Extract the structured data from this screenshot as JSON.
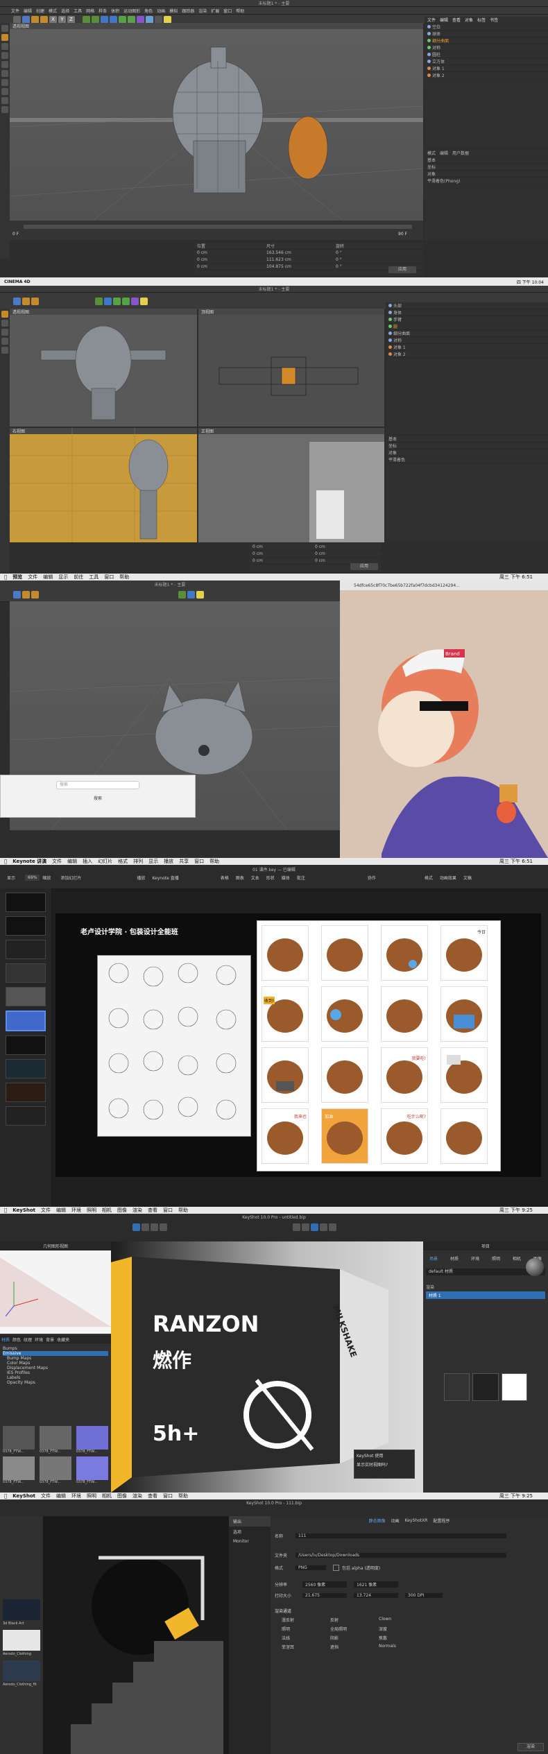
{
  "c4d_1": {
    "window_title": "未标题1 * - 主要",
    "menu_items": [
      "文件",
      "编辑",
      "创建",
      "模式",
      "选择",
      "工具",
      "网格",
      "样条",
      "体积",
      "运动图形",
      "角色",
      "动画",
      "模拟",
      "跟踪器",
      "渲染",
      "扩展",
      "窗口",
      "帮助"
    ],
    "tool_letters": [
      "X",
      "Y",
      "Z"
    ],
    "viewport_label": "透视视图",
    "object_manager_tabs": [
      "文件",
      "编辑",
      "查看",
      "对象",
      "标签",
      "书签"
    ],
    "objects": [
      "空白",
      "球体",
      "细分曲面",
      "对称",
      "圆柱",
      "立方体",
      "对象 1",
      "对象 2"
    ],
    "attribute_tabs": [
      "模式",
      "编辑",
      "用户数据"
    ],
    "attributes": [
      "基本",
      "坐标",
      "对象",
      "平滑着色(Phong)"
    ],
    "timeline_start": "0 F",
    "timeline_end": "90 F",
    "coord_headers": [
      "位置",
      "尺寸",
      "旋转"
    ],
    "coord_values": [
      "0 cm",
      "0 cm",
      "0 cm",
      "163.546 cm",
      "111.623 cm",
      "104.875 cm",
      "0 °",
      "0 °",
      "0 °"
    ],
    "apply_button": "应用",
    "bottom_bar_left": "CINEMA 4D",
    "bottom_bar_right": "四 下午 10:04"
  },
  "c4d_2": {
    "window_title": "未标题1 * - 主要",
    "viewports": [
      "透视视图",
      "顶视图",
      "右视图",
      "正视图"
    ],
    "objects": [
      "头部",
      "身体",
      "手臂",
      "腿",
      "细分曲面",
      "对称",
      "对象 1",
      "对象 2"
    ],
    "attributes": [
      "基本",
      "坐标",
      "对象",
      "平滑着色"
    ],
    "coord_values": [
      "0 cm",
      "0 cm",
      "0 cm",
      "0 cm",
      "0 cm",
      "0 cm"
    ],
    "apply_button": "应用"
  },
  "c4d_3": {
    "mac_menu": [
      "",
      "预览",
      "文件",
      "编辑",
      "显示",
      "前往",
      "工具",
      "窗口",
      "帮助"
    ],
    "window_title": "未标题1 * - 主要",
    "preview_filename": "54dfce65c8f70c7be65b722fa04f7dcbd34124294...",
    "clock": "周三 下午 6:51",
    "search_placeholder": "搜索",
    "search_label": "搜索",
    "cap_text": "Brand"
  },
  "keynote": {
    "mac_menu": [
      "",
      "Keynote 讲演",
      "文件",
      "编辑",
      "插入",
      "幻灯片",
      "格式",
      "排列",
      "显示",
      "播放",
      "共享",
      "窗口",
      "帮助"
    ],
    "file_title": "01 课件.key — 已编辑",
    "zoom": "69%",
    "toolbar_items": [
      "显示",
      "缩放",
      "添加幻灯片",
      "播放",
      "Keynote 直播",
      "表格",
      "图表",
      "文本",
      "形状",
      "媒体",
      "批注",
      "协作",
      "格式",
      "动画效果",
      "文稿"
    ],
    "slide_title": "老卢设计学院 · 包装设计全能班",
    "clock": "周三 下午 6:51",
    "speech_bubbles": [
      "收到!",
      "我要吃!",
      "今日",
      "我来也",
      "吃什么呢?",
      "加油"
    ]
  },
  "keyshot_1": {
    "mac_menu": [
      "",
      "KeyShot",
      "文件",
      "编辑",
      "环境",
      "照明",
      "相机",
      "图像",
      "渲染",
      "查看",
      "窗口",
      "帮助"
    ],
    "window_title": "KeyShot 10.0 Pro - untitled.bip",
    "library_title": "几何图形视图",
    "library_tabs": [
      "材质",
      "颜色",
      "纹理",
      "环境",
      "背景",
      "收藏夹"
    ],
    "library_items": [
      "Bumps",
      "Emissive",
      "Bump Maps",
      "Color Maps",
      "Displacement Maps",
      "IES Profiles",
      "Labels",
      "Opacity Maps"
    ],
    "texture_thumbs": [
      "0378_FTW...",
      "0378_FTW...",
      "0378_FTW...",
      "0378_FTW...",
      "0378_FTW...",
      "0378_FTW..."
    ],
    "product_brand": "RANZON",
    "product_cn": "燃作",
    "product_side": "MILKSHAKE",
    "product_number": "5h+",
    "project_title": "项目",
    "project_tabs": [
      "场景",
      "材质",
      "环境",
      "照明",
      "相机",
      "图像"
    ],
    "popup_lines": [
      "KeyShot 使用",
      "显示实时视图吗?"
    ],
    "right_items": [
      "default 材质",
      "渲染",
      "材质 1"
    ],
    "clock": "周三 下午 9:25"
  },
  "keyshot_2": {
    "mac_menu": [
      "",
      "KeyShot",
      "文件",
      "编辑",
      "环境",
      "照明",
      "相机",
      "图像",
      "渲染",
      "查看",
      "窗口",
      "帮助"
    ],
    "window_title": "KeyShot 10.0 Pro - 111.bip",
    "render_tabs": [
      "静态图像",
      "动画",
      "KeyShotXR",
      "配置程序"
    ],
    "render_sidebar": [
      "输出",
      "选项",
      "Monitor"
    ],
    "name_label": "名称",
    "name_value": "111",
    "folder_label": "文件夹",
    "folder_value": "/Users/lu/Desktop/Downloads",
    "format_label": "格式",
    "format_value": "PNG",
    "alpha_label": "包括 alpha (透明度)",
    "resolution_label": "分辨率",
    "resolution_w": "2560 像素",
    "resolution_h": "1621 像素",
    "print_label": "打印大小",
    "print_w": "21.675",
    "print_h": "13.724",
    "dpi": "300 DPI",
    "passes_label": "渲染通道",
    "passes": [
      "漫反射",
      "反射",
      "Clown",
      "照明",
      "全局照明",
      "深度",
      "法线",
      "阴影",
      "焦散",
      "菲涅耳",
      "遮挡",
      "Normals"
    ],
    "environments": [
      "3d Black Art",
      "Aerodo_Clothing",
      "Aerodo_Clothing_Hi"
    ],
    "render_button": "渲染",
    "clock": "周三 下午 9:25"
  }
}
